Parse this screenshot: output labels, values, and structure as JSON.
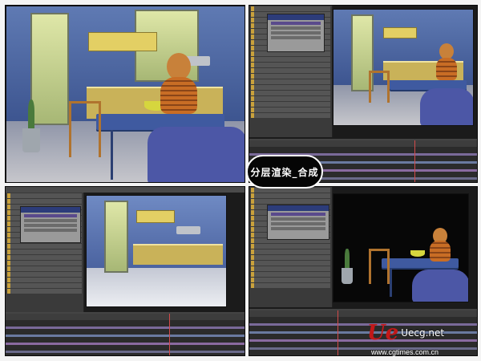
{
  "caption": "分层渲染_合成",
  "watermark": {
    "mark": "Ue",
    "site": "Uecg.net",
    "url": "www.cgtimes.com.cn"
  },
  "colors": {
    "accent": "#c31818",
    "wall": "#5f7ab3",
    "cabinet": "#e3cf64",
    "timeline_needle": "#d24a4a"
  }
}
